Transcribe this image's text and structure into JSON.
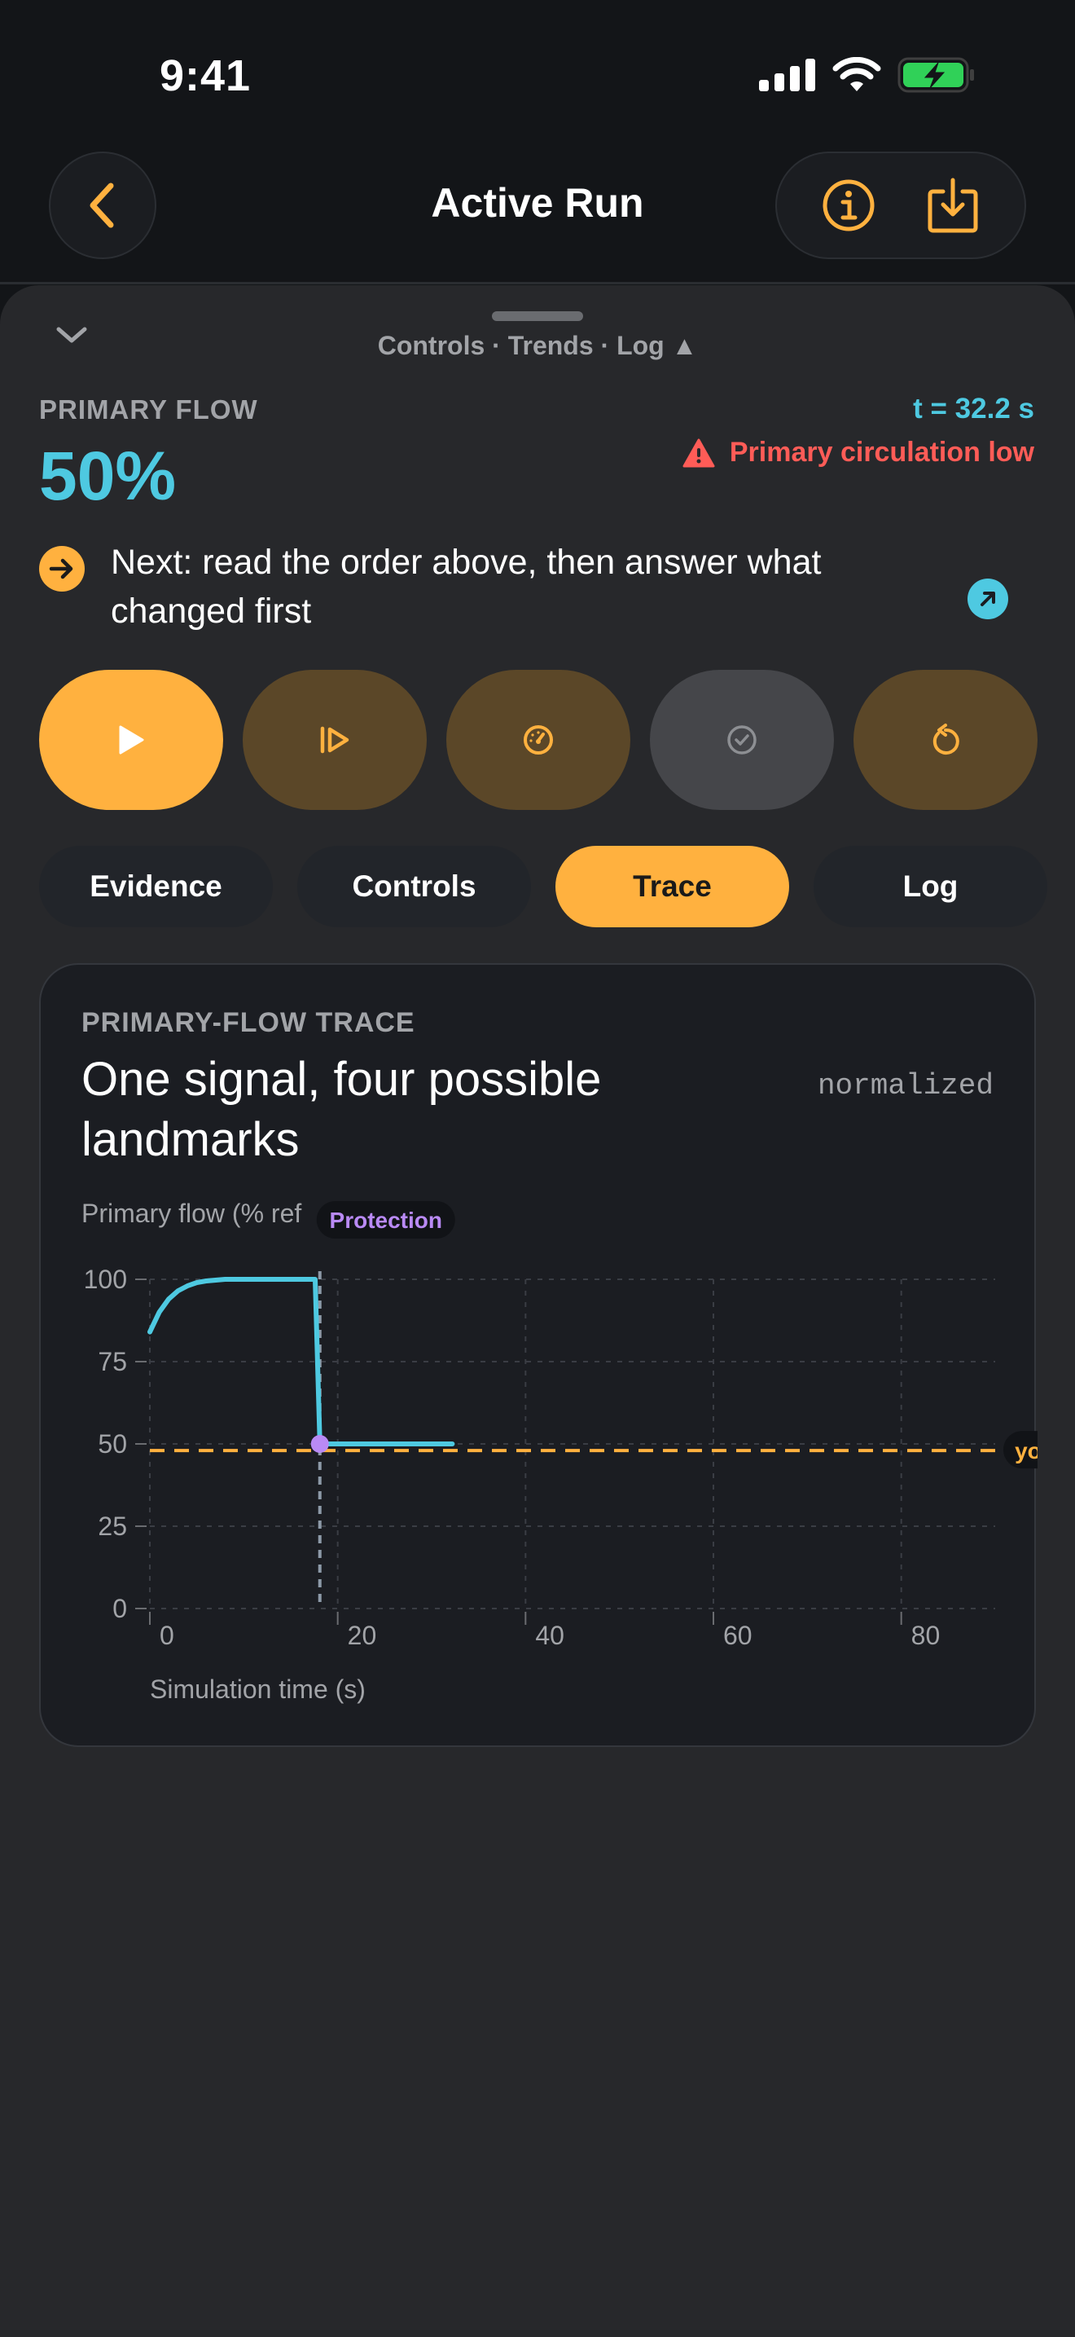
{
  "status": {
    "time": "9:41"
  },
  "nav": {
    "title": "Active Run"
  },
  "sheet": {
    "header": "Controls · Trends · Log ▲",
    "flow_label": "PRIMARY FLOW",
    "flow_value": "50%",
    "sim_time": "t = 32.2 s",
    "alarm": "Primary circulation low",
    "next": "Next: read the order above, then answer what changed first"
  },
  "controls": [
    {
      "icon": "play-icon",
      "state": "primary"
    },
    {
      "icon": "step-icon",
      "state": "brown"
    },
    {
      "icon": "gauge-icon",
      "state": "brown"
    },
    {
      "icon": "check-circle-icon",
      "state": "gray"
    },
    {
      "icon": "reset-icon",
      "state": "brown"
    }
  ],
  "tabs": [
    "Evidence",
    "Controls",
    "Trace",
    "Log"
  ],
  "active_tab": "Trace",
  "colors": {
    "accent": "#ffb13f",
    "flow": "#4ec9e1",
    "alarm": "#ff5c57",
    "marker": "#b98af5"
  },
  "card": {
    "kicker": "PRIMARY-FLOW TRACE",
    "title": "One signal, four possible landmarks",
    "normalized": "normalized"
  },
  "chart_data": {
    "type": "line",
    "ylabel": "Primary flow (% ref",
    "xlabel": "Simulation time (s)",
    "xlim": [
      0,
      90
    ],
    "ylim": [
      0,
      100
    ],
    "x_ticks": [
      0,
      20,
      40,
      60,
      80
    ],
    "y_ticks": [
      0,
      25,
      50,
      75,
      100
    ],
    "grid": true,
    "series": [
      {
        "values": [
          [
            0,
            84
          ],
          [
            1,
            90
          ],
          [
            2,
            94
          ],
          [
            3,
            96.5
          ],
          [
            4,
            98
          ],
          [
            5,
            99
          ],
          [
            6,
            99.5
          ],
          [
            8,
            100
          ],
          [
            12,
            100
          ],
          [
            17.6,
            100
          ],
          [
            18.1,
            50
          ],
          [
            18.5,
            50
          ],
          [
            20,
            50
          ],
          [
            25,
            50
          ],
          [
            32.2,
            50
          ]
        ]
      }
    ],
    "event_marker": {
      "label": "Protection",
      "x": 18.1,
      "y": 50
    },
    "reference_line": {
      "label": "you",
      "y": 48
    }
  }
}
